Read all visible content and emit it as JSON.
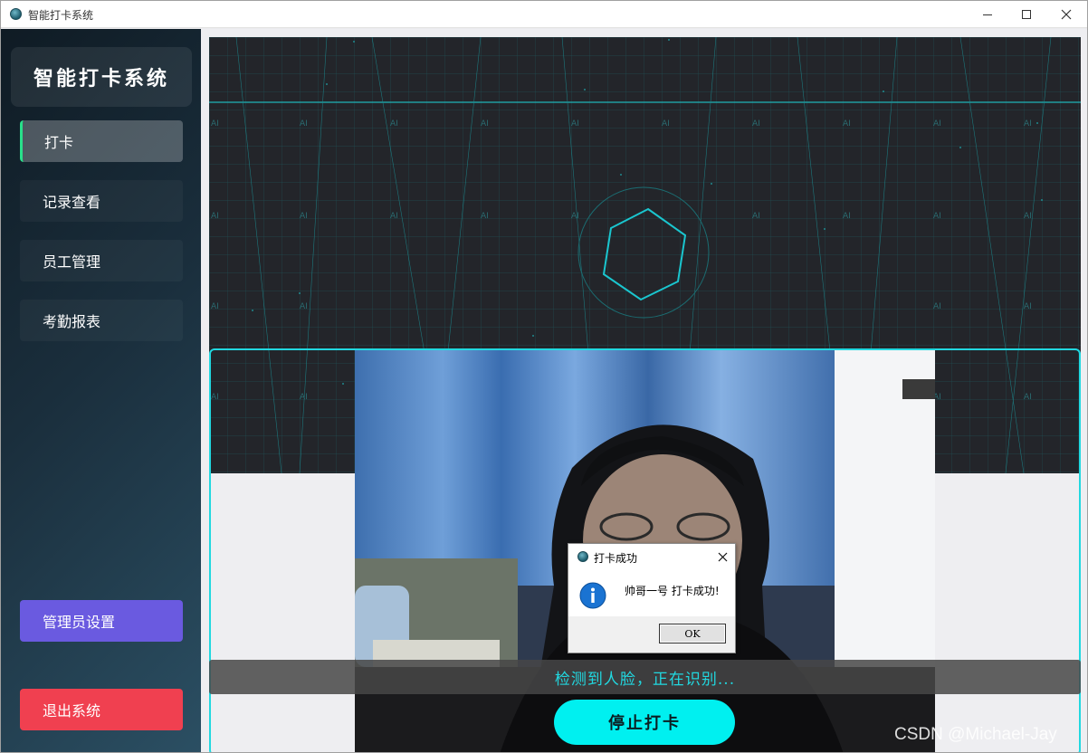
{
  "window": {
    "title": "智能打卡系统"
  },
  "sidebar": {
    "brand": "智能打卡系统",
    "items": [
      {
        "label": "打卡",
        "active": true
      },
      {
        "label": "记录查看",
        "active": false
      },
      {
        "label": "员工管理",
        "active": false
      },
      {
        "label": "考勤报表",
        "active": false
      }
    ],
    "admin_button": "管理员设置",
    "exit_button": "退出系统"
  },
  "main": {
    "status_text": "检测到人脸，正在识别...",
    "stop_button": "停止打卡",
    "hero_watermark": "AI"
  },
  "dialog": {
    "title": "打卡成功",
    "message": "帅哥一号 打卡成功!",
    "ok_label": "OK"
  },
  "watermark": "CSDN @Michael-Jay",
  "colors": {
    "accent_cyan": "#21d8e0",
    "active_indicator": "#29e08a",
    "admin_button": "#6a5ae0",
    "exit_button": "#f04050",
    "stop_button": "#00f0f0"
  },
  "icons": {
    "app": "app-logo-icon",
    "info": "info-icon",
    "close": "close-icon"
  }
}
